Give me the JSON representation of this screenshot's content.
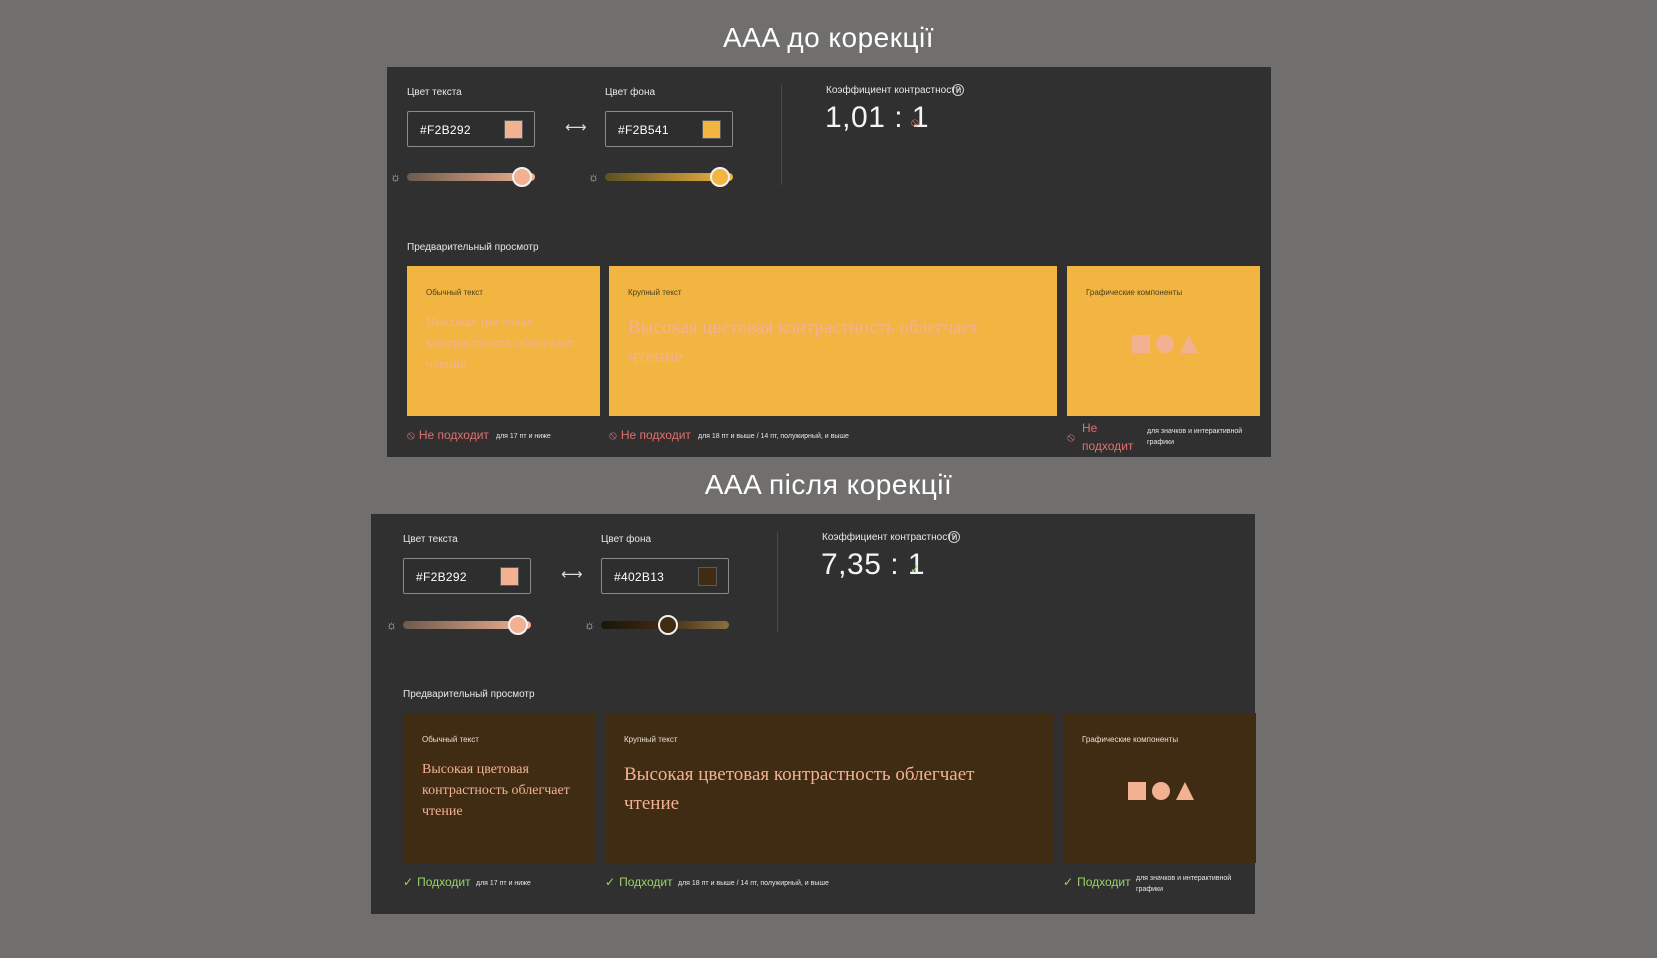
{
  "sections": [
    {
      "title": "AAA до корекції",
      "text_color_label": "Цвет текста",
      "text_color_hex": "#F2B292",
      "bg_color_label": "Цвет фона",
      "bg_color_hex": "#F2B541",
      "text_brightness": 0.9,
      "bg_brightness": 0.9,
      "contrast_label": "Коэффициент контрастности",
      "contrast_value": "1,01 : 1",
      "contrast_pass": false,
      "preview_label": "Предварительный просмотр",
      "cards": {
        "normal_title": "Обычный текст",
        "normal_body": "Высокая цветовая контрастность облегчает чтение",
        "large_title": "Крупный текст",
        "large_body": "Высокая цветовая контрастность облегчает чтение",
        "graphic_title": "Графические компоненты"
      },
      "verdicts": {
        "normal": "Не подходит",
        "normal_note": "для 17 пт и ниже",
        "large": "Не подходит",
        "large_note": "для 18 пт и выше / 14 пт, полужирный, и выше",
        "graphic": "Не подходит",
        "graphic_note": "для значков и интерактивной графики"
      }
    },
    {
      "title": "AAA після корекції",
      "text_color_label": "Цвет текста",
      "text_color_hex": "#F2B292",
      "bg_color_label": "Цвет фона",
      "bg_color_hex": "#402B13",
      "text_brightness": 0.9,
      "bg_brightness": 0.52,
      "contrast_label": "Коэффициент контрастности",
      "contrast_value": "7,35 : 1",
      "contrast_pass": true,
      "preview_label": "Предварительный просмотр",
      "cards": {
        "normal_title": "Обычный текст",
        "normal_body": "Высокая цветовая контрастность облегчает чтение",
        "large_title": "Крупный текст",
        "large_body": "Высокая цветовая контрастность облегчает чтение",
        "graphic_title": "Графические компоненты"
      },
      "verdicts": {
        "normal": "Подходит",
        "normal_note": "для 17 пт и ниже",
        "large": "Подходит",
        "large_note": "для 18 пт и выше / 14 пт, полужирный, и выше",
        "graphic": "Подходит",
        "graphic_note": "для значков и интерактивной графики"
      }
    }
  ],
  "colors": {
    "fail": "#e07070",
    "pass": "#9ad46a",
    "text_track_start": "#6d5a4c",
    "bg1_track_start": "#5c5020",
    "bg2_track_start": "#1a140c",
    "bg2_track_end": "#8a7040"
  }
}
